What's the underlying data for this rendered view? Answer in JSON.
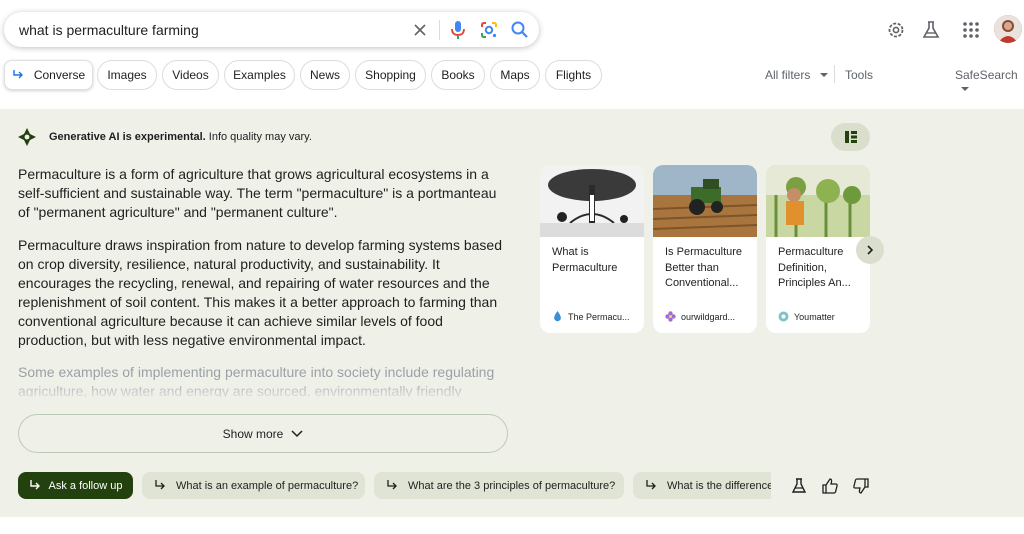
{
  "search": {
    "query": "what is permaculture farming"
  },
  "chips": [
    {
      "label": "Converse"
    },
    {
      "label": "Images"
    },
    {
      "label": "Videos"
    },
    {
      "label": "Examples"
    },
    {
      "label": "News"
    },
    {
      "label": "Shopping"
    },
    {
      "label": "Books"
    },
    {
      "label": "Maps"
    },
    {
      "label": "Flights"
    }
  ],
  "filters": {
    "all_filters": "All filters",
    "tools": "Tools",
    "safesearch": "SafeSearch"
  },
  "sge": {
    "notice_bold": "Generative AI is experimental.",
    "notice_rest": "Info quality may vary.",
    "paragraph1": "Permaculture is a form of agriculture that grows agricultural ecosystems in a self-sufficient and sustainable way. The term \"permaculture\" is a portmanteau of \"permanent agriculture\" and \"permanent culture\".",
    "paragraph2": "Permaculture draws inspiration from nature to develop farming systems based on crop diversity, resilience, natural productivity, and sustainability. It encourages the recycling, renewal, and repairing of water resources and the replenishment of soil content. This makes it a better approach to farming than conventional agriculture because it can achieve similar levels of food production, but with less negative environmental impact.",
    "paragraph3": "Some examples of implementing permaculture into society include regulating agriculture, how water and energy are sourced, environmentally friendly",
    "show_more": "Show more",
    "accent": "#23410f"
  },
  "cards": [
    {
      "title": "What is Permaculture",
      "source": "The Permacu..."
    },
    {
      "title": "Is Permaculture Better than Conventional...",
      "source": "ourwildgard..."
    },
    {
      "title": "Permaculture Definition, Principles An...",
      "source": "Youmatter"
    }
  ],
  "followups": {
    "ask": "Ask a follow up",
    "items": [
      {
        "label": "What is an example of permaculture?"
      },
      {
        "label": "What are the 3 principles of permaculture?"
      },
      {
        "label": "What is the difference"
      }
    ]
  }
}
